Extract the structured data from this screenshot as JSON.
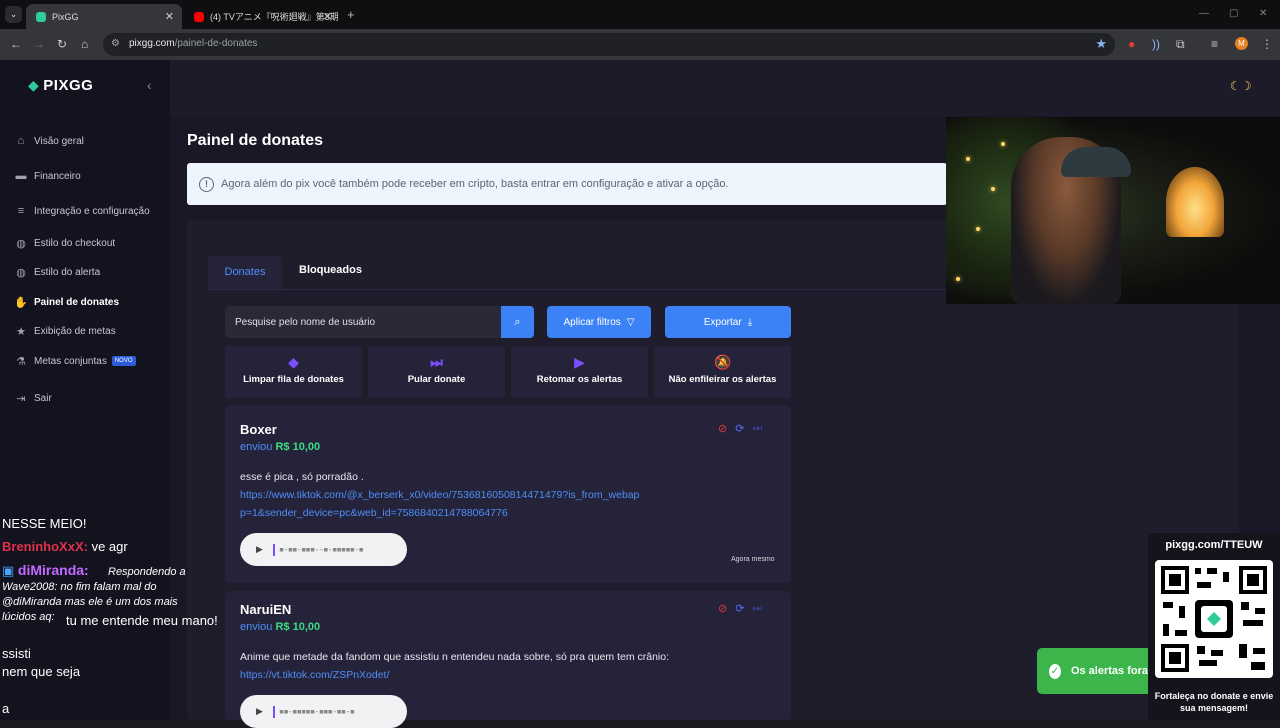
{
  "browser": {
    "tabs": [
      {
        "title": "PixGG",
        "active": true
      },
      {
        "title": "(4) TVアニメ『呪術廻戦』第3期「死"
      }
    ],
    "new_tab_label": "+",
    "url_domain": "pixgg.com",
    "url_path": "/painel-de-donates",
    "profile_initial": "M",
    "nav": {
      "back": "←",
      "forward": "→",
      "reload": "↻",
      "home": "⌂"
    },
    "window": {
      "minimize": "—",
      "maximize": "▢",
      "close": "✕"
    }
  },
  "sidebar": {
    "brand": "PIXGG",
    "collapse_icon": "‹",
    "items": [
      {
        "label": "Visão geral",
        "icon": "⌂"
      },
      {
        "label": "Financeiro",
        "icon": "▬"
      },
      {
        "label": "Integração e configuração",
        "icon": "≡"
      },
      {
        "label": "Estilo do checkout",
        "icon": "◍"
      },
      {
        "label": "Estilo do alerta",
        "icon": "◍"
      },
      {
        "label": "Painel de donates",
        "icon": "✋",
        "active": true
      },
      {
        "label": "Exibição de metas",
        "icon": "★"
      },
      {
        "label": "Metas conjuntas",
        "icon": "⚗",
        "badge": "NOVO"
      },
      {
        "label": "Sair",
        "icon": "⇥"
      }
    ]
  },
  "main": {
    "title": "Painel de donates",
    "info": "Agora além do pix você também pode receber em cripto, basta entrar em configuração e ativar a opção.",
    "tabs": [
      {
        "label": "Donates",
        "active": true
      },
      {
        "label": "Bloqueados"
      }
    ],
    "search_placeholder": "Pesquise pelo nome de usuário",
    "filter_button": "Aplicar filtros",
    "export_button": "Exportar",
    "actions": [
      {
        "label": "Limpar fila de donates",
        "icon": "eraser-icon"
      },
      {
        "label": "Pular donate",
        "icon": "skip-icon"
      },
      {
        "label": "Retomar os alertas",
        "icon": "play-icon"
      },
      {
        "label": "Não enfileirar os alertas",
        "icon": "bell-off-icon"
      }
    ],
    "donates": [
      {
        "name": "Boxer",
        "sent_label": "enviou",
        "amount": "R$ 10,00",
        "message": "esse é pica , só porradão .",
        "link": "https://www.tiktok.com/@x_berserk_x0/video/7536816050814471479?is_from_webapp=1&sender_device=pc&web_id=7586840214788064776",
        "time": "Agora mesmo"
      },
      {
        "name": "NaruiEN",
        "sent_label": "enviou",
        "amount": "R$ 10,00",
        "message": "Anime que metade da fandom que assistiu n entendeu nada sobre, só pra quem tem crânio:",
        "link": "https://vt.tiktok.com/ZSPnXodet/"
      }
    ]
  },
  "overlay": {
    "chat": [
      {
        "text": "NESSE MEIO!"
      },
      {
        "user": "BreninhoXxX:",
        "text": "ve agr"
      },
      {
        "user": "diMiranda:",
        "reply": "Respondendo a Wave2008: no fim falam mal do @diMiranda mas ele é um dos mais lúcidos aq:",
        "text": "tu me entende meu mano!"
      },
      {
        "text": "ssisti"
      },
      {
        "text": "nem que seja"
      },
      {
        "text": "a"
      }
    ],
    "qr_title": "pixgg.com/TTEUW",
    "qr_footer": "Fortaleça no donate e envie sua mensagem!",
    "toast": "Os alertas fora"
  },
  "colors": {
    "accent": "#3b82f6",
    "amount_green": "#3ddc84",
    "action_purple": "#7c4dff",
    "brand_green": "#2ecc9a"
  }
}
